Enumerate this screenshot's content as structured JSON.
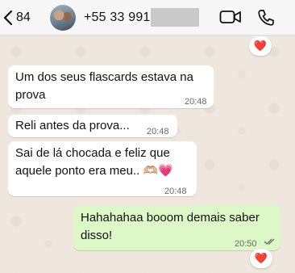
{
  "header": {
    "back_count": "84",
    "contact_name": "+55 33 991",
    "icons": [
      "chevron-left-icon",
      "video-camera-icon",
      "phone-icon"
    ]
  },
  "messages": [
    {
      "direction": "in",
      "text": "Um dos seus flascards estava na prova",
      "time": "20:48"
    },
    {
      "direction": "in",
      "text": "Reli antes da prova...",
      "time": "20:48"
    },
    {
      "direction": "in",
      "text": "Sai de lá chocada e feliz que aquele ponto era meu.. 🫶🏼💗",
      "time": "20:48"
    },
    {
      "direction": "out",
      "text": "Hahahahaa booom demais saber disso!",
      "time": "20:50"
    }
  ],
  "reactions": {
    "top": "❤️",
    "last_message": "❤️"
  },
  "colors": {
    "chat_bg": "#efe7dd",
    "incoming_bubble": "#ffffff",
    "outgoing_bubble": "#dcf8c6",
    "read_ticks": "#6b6b6b"
  }
}
